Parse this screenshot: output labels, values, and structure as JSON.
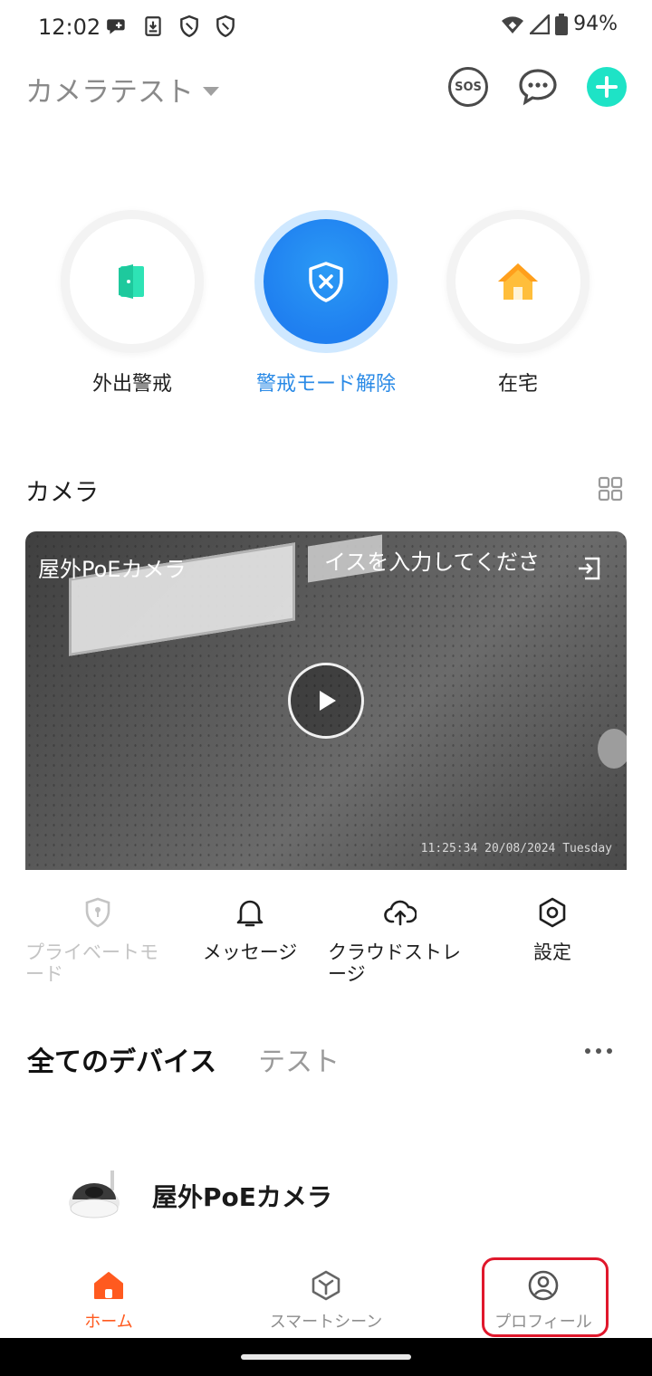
{
  "status_bar": {
    "time": "12:02",
    "battery": "94%"
  },
  "header": {
    "home_name": "カメラテスト",
    "sos_label": "SOS"
  },
  "modes": [
    {
      "label": "外出警戒"
    },
    {
      "label": "警戒モード解除",
      "active": true
    },
    {
      "label": "在宅"
    }
  ],
  "camera_section": {
    "title": "カメラ",
    "card": {
      "name": "屋外PoEカメラ",
      "overlay_text": "イスを入力してくださ",
      "timestamp": "11:25:34 20/08/2024 Tuesday"
    },
    "actions": [
      {
        "label": "プライベートモード",
        "enabled": false
      },
      {
        "label": "メッセージ",
        "enabled": true
      },
      {
        "label": "クラウドストレージ",
        "enabled": true
      },
      {
        "label": "設定",
        "enabled": true
      }
    ]
  },
  "device_tabs": [
    {
      "label": "全てのデバイス",
      "active": true
    },
    {
      "label": "テスト",
      "active": false
    }
  ],
  "devices": [
    {
      "name": "屋外PoEカメラ"
    }
  ],
  "bottom_nav": [
    {
      "label": "ホーム",
      "active": true
    },
    {
      "label": "スマートシーン",
      "active": false
    },
    {
      "label": "プロフィール",
      "active": false
    }
  ],
  "colors": {
    "accent": "#1ee3c6",
    "active_blue": "#1f7ff0",
    "nav_active": "#ff5a1f",
    "highlight": "#e0182c"
  }
}
